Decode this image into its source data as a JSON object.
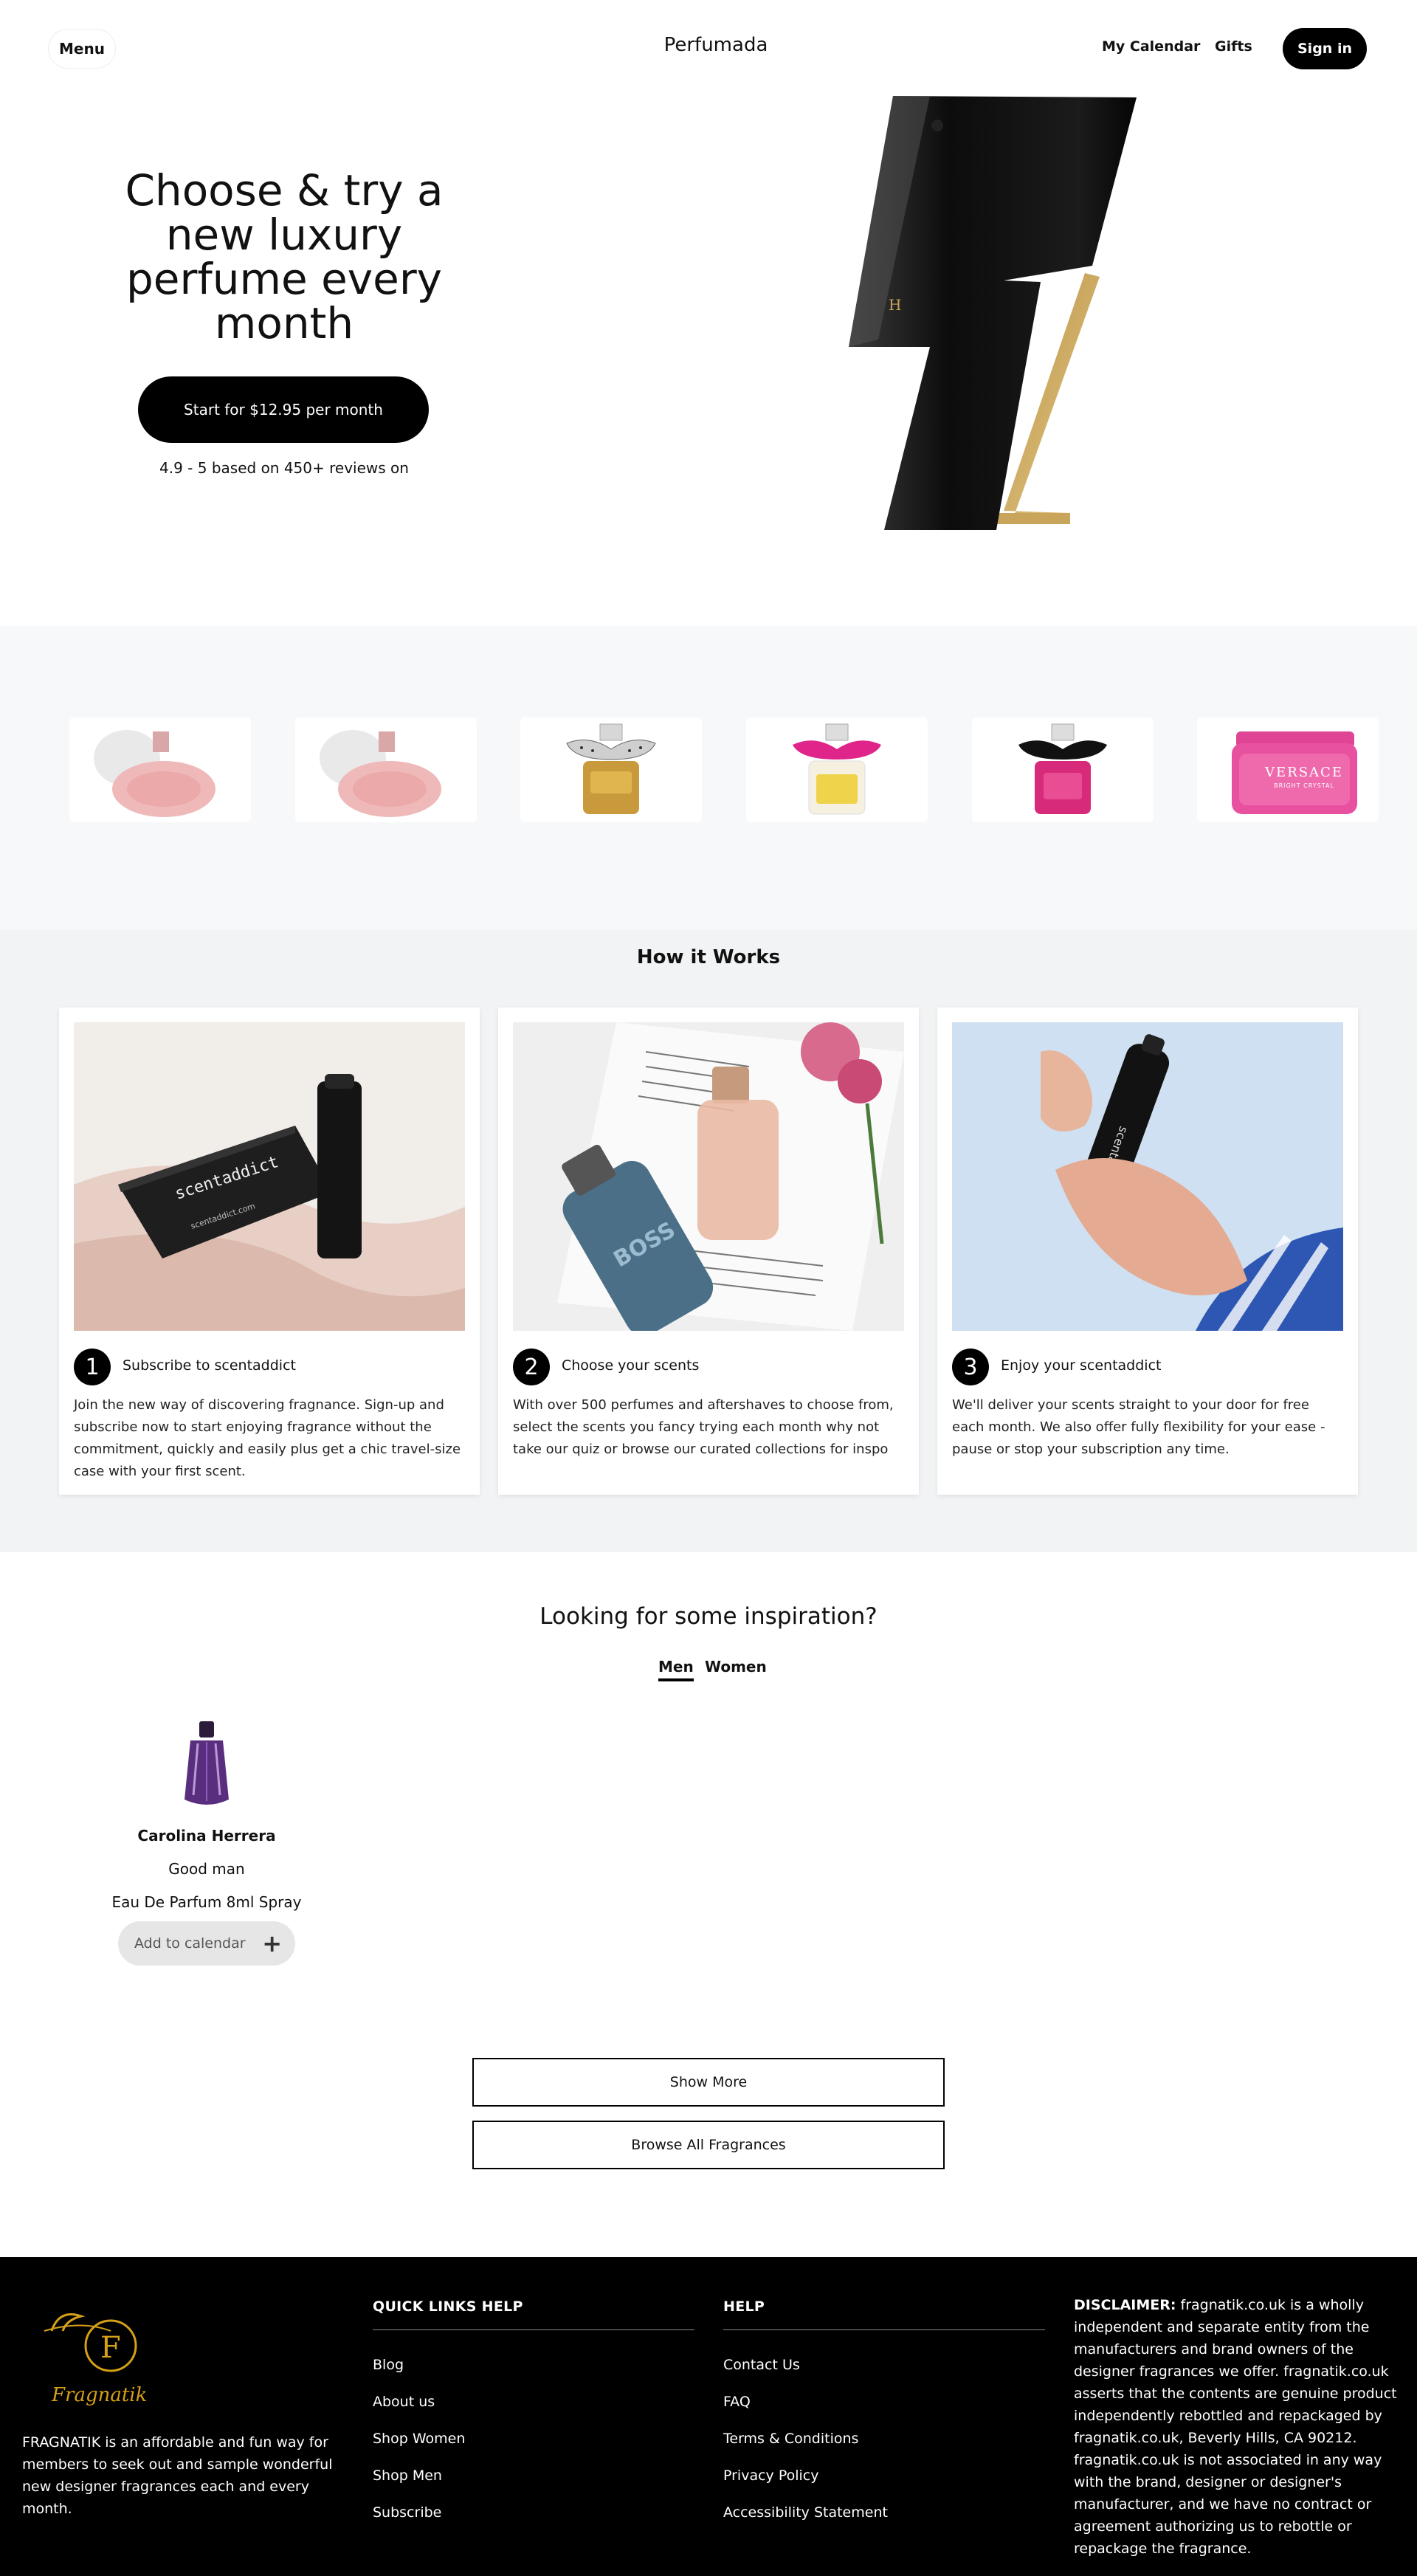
{
  "header": {
    "menu_label": "Menu",
    "brand": "Perfumada",
    "nav": {
      "calendar": "My Calendar",
      "gifts": "Gifts"
    },
    "signin_label": "Sign in"
  },
  "hero": {
    "title": "Choose & try a new luxury perfume every month",
    "cta_label": "Start for $12.95 per month",
    "reviews": "4.9 - 5 based on 450+ reviews on"
  },
  "carousel": {
    "items": [
      {
        "icon": "pink-round-bottle"
      },
      {
        "icon": "pink-round-bottle"
      },
      {
        "icon": "gold-bottle-bow"
      },
      {
        "icon": "pink-bow-bottle"
      },
      {
        "icon": "black-bow-bottle"
      },
      {
        "icon": "pink-versace-bottle",
        "label": "VERSACE",
        "sublabel": "BRIGHT CRYSTAL"
      }
    ]
  },
  "how_it_works": {
    "title": "How it Works",
    "steps": [
      {
        "number": "1",
        "title": "Subscribe to scentaddict",
        "text": "Join the new way of discovering fragnance. Sign-up and subscribe now to start enjoying fragrance without the commitment, quickly and easily plus get a chic travel-size case with your first scent.",
        "image_caption": "scentaddict",
        "image_sub": "scentaddict.com"
      },
      {
        "number": "2",
        "title": "Choose your scents",
        "text": "With over 500 perfumes and aftershaves to choose from, select the scents you fancy trying each month why not take our quiz or browse our curated collections for inspo",
        "image_caption": "BOSS"
      },
      {
        "number": "3",
        "title": "Enjoy your scentaddict",
        "text": "We'll deliver your scents straight to your door for free each month. We also offer fully flexibility for your ease - pause or stop your subscription any time.",
        "image_caption": "scentad"
      }
    ]
  },
  "inspiration": {
    "title": "Looking for some inspiration?",
    "tabs": [
      "Men",
      "Women"
    ],
    "product": {
      "brand": "Carolina Herrera",
      "name": "Good man",
      "size": "Eau De Parfum 8ml Spray",
      "add_label": "Add to calendar",
      "add_icon": "+"
    },
    "show_more": "Show More",
    "browse_all": "Browse All Fragrances"
  },
  "footer": {
    "logo_text": "Fragnatik",
    "about": "FRAGNATIK is an affordable and fun way for members to seek out and sample wonderful new designer fragrances each and every month.",
    "quick_links": {
      "heading": "QUICK LINKS HELP",
      "links": [
        "Blog",
        "About us",
        "Shop Women",
        "Shop Men",
        "Subscribe"
      ]
    },
    "help": {
      "heading": "HELP",
      "links": [
        "Contact Us",
        "FAQ",
        "Terms & Conditions",
        "Privacy Policy",
        "Accessibility Statement"
      ]
    },
    "disclaimer_label": "DISCLAIMER:",
    "disclaimer_text": " fragnatik.co.uk is a wholly independent and separate entity from the manufacturers and brand owners of the designer fragrances we offer. fragnatik.co.uk asserts that the contents are genuine product independently rebottled and repackaged by fragnatik.co.uk, Beverly Hills, CA 90212. fragnatik.co.uk is not associated in any way with the brand, designer or designer's manufacturer, and we have no contract or agreement authorizing us to rebottle or repackage the fragrance."
  },
  "colors": {
    "primary": "#000000",
    "background": "#ffffff",
    "section_gray": "#f2f3f4",
    "logo_gold": "#d4a017"
  }
}
